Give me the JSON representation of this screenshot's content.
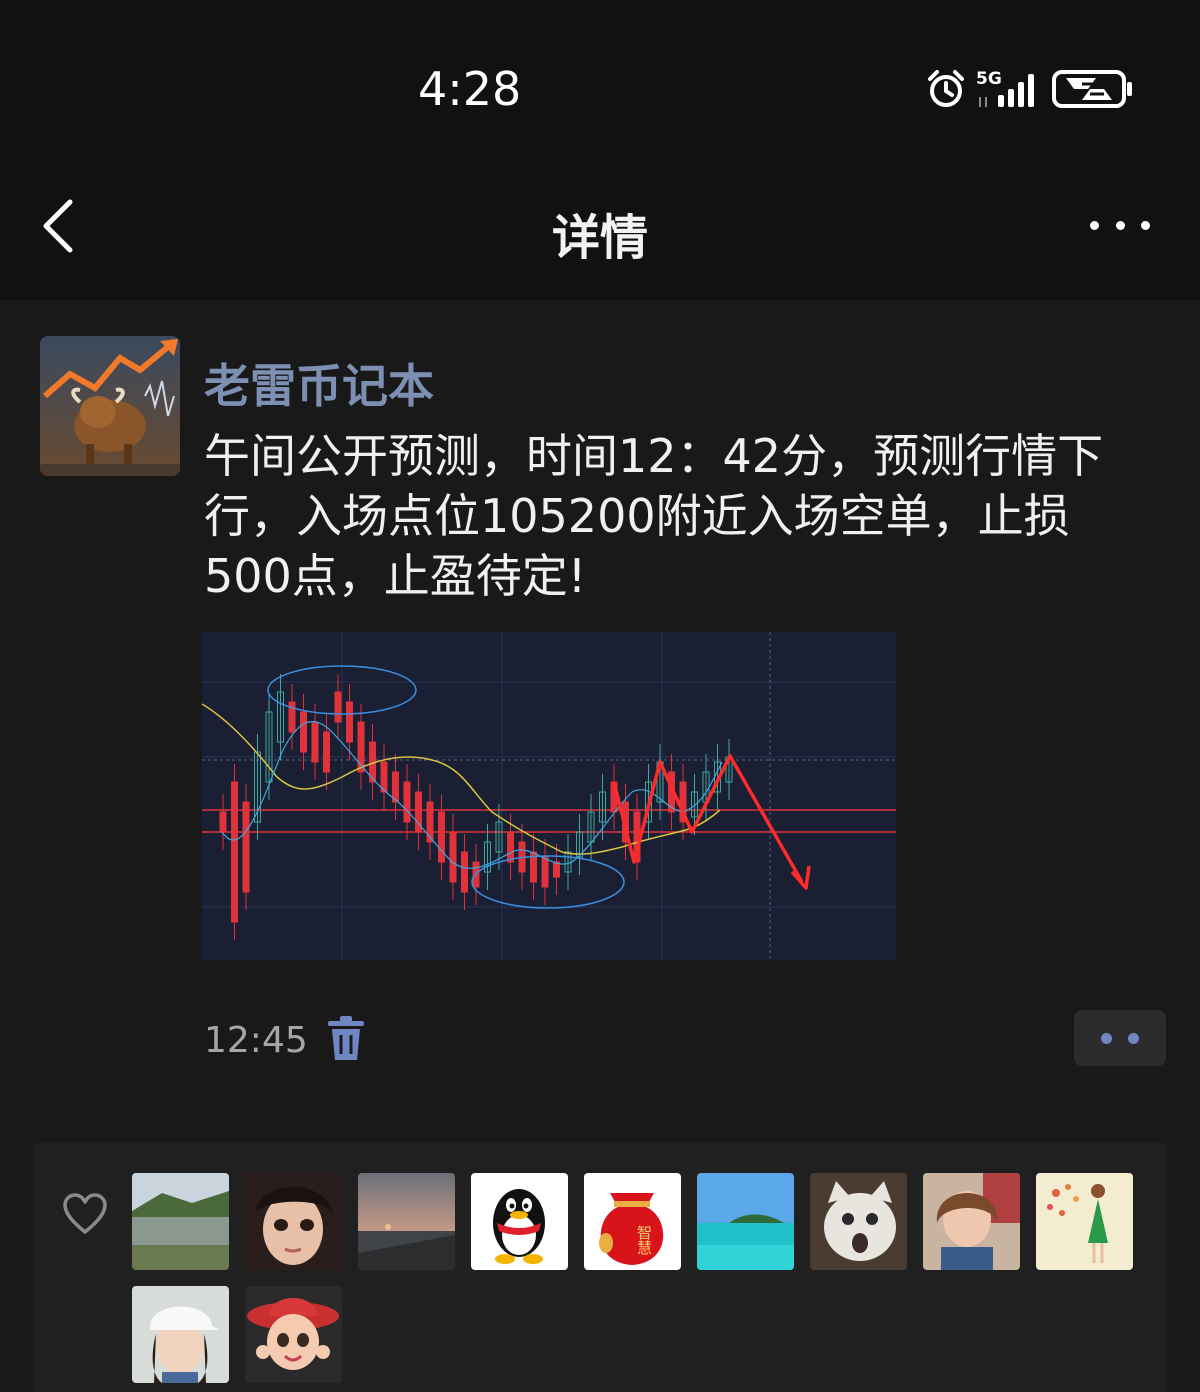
{
  "status_bar": {
    "time": "4:28",
    "network": "5G",
    "icons": [
      "alarm-icon",
      "signal-icon",
      "battery-saver-icon"
    ]
  },
  "nav": {
    "title": "详情",
    "back_icon": "chevron-left-icon",
    "more_icon": "more-dots-icon"
  },
  "post": {
    "author": "老雷币记本",
    "avatar_icon": "bull-chart-avatar",
    "text": "午间公开预测，时间12：42分，预测行情下行，入场点位105200附近入场空单，止损500点，止盈待定!",
    "image_icon": "candlestick-chart-image",
    "time": "12:45",
    "delete_icon": "trash-icon",
    "comment_icon": "comment-dots-icon"
  },
  "likes": {
    "heart_icon": "heart-outline-icon",
    "users": [
      {
        "icon": "lake-landscape-avatar"
      },
      {
        "icon": "girl-face-avatar"
      },
      {
        "icon": "sunset-bridge-avatar"
      },
      {
        "icon": "qq-penguin-avatar",
        "text": ""
      },
      {
        "icon": "red-lucky-bag-avatar",
        "text": "智慧"
      },
      {
        "icon": "sea-island-avatar"
      },
      {
        "icon": "white-cat-avatar"
      },
      {
        "icon": "child-portrait-avatar"
      },
      {
        "icon": "green-dress-illustration-avatar"
      },
      {
        "icon": "woman-cap-avatar"
      },
      {
        "icon": "cartoon-red-hat-girl-avatar"
      }
    ]
  },
  "colors": {
    "background": "#191919",
    "header": "#111111",
    "author": "#7d8fb3",
    "accent_blue": "#6f86c3",
    "chart_bg": "#1a1f33",
    "candle_red": "#e0323a",
    "candle_green": "#3fa9a0"
  }
}
